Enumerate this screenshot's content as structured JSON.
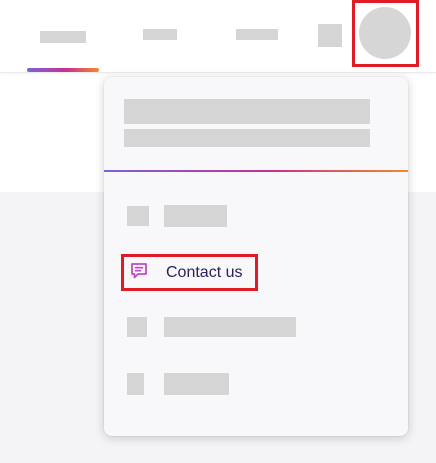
{
  "menu": {
    "contact_label": "Contact us"
  },
  "icons": {
    "contact": "chat-bubble-icon"
  },
  "colors": {
    "accent_gradient": [
      "#7b63d6",
      "#c8318f",
      "#f08a2c"
    ],
    "highlight": "#e01b24",
    "contact_icon": "#c248c9",
    "text": "#2a1f5a"
  }
}
